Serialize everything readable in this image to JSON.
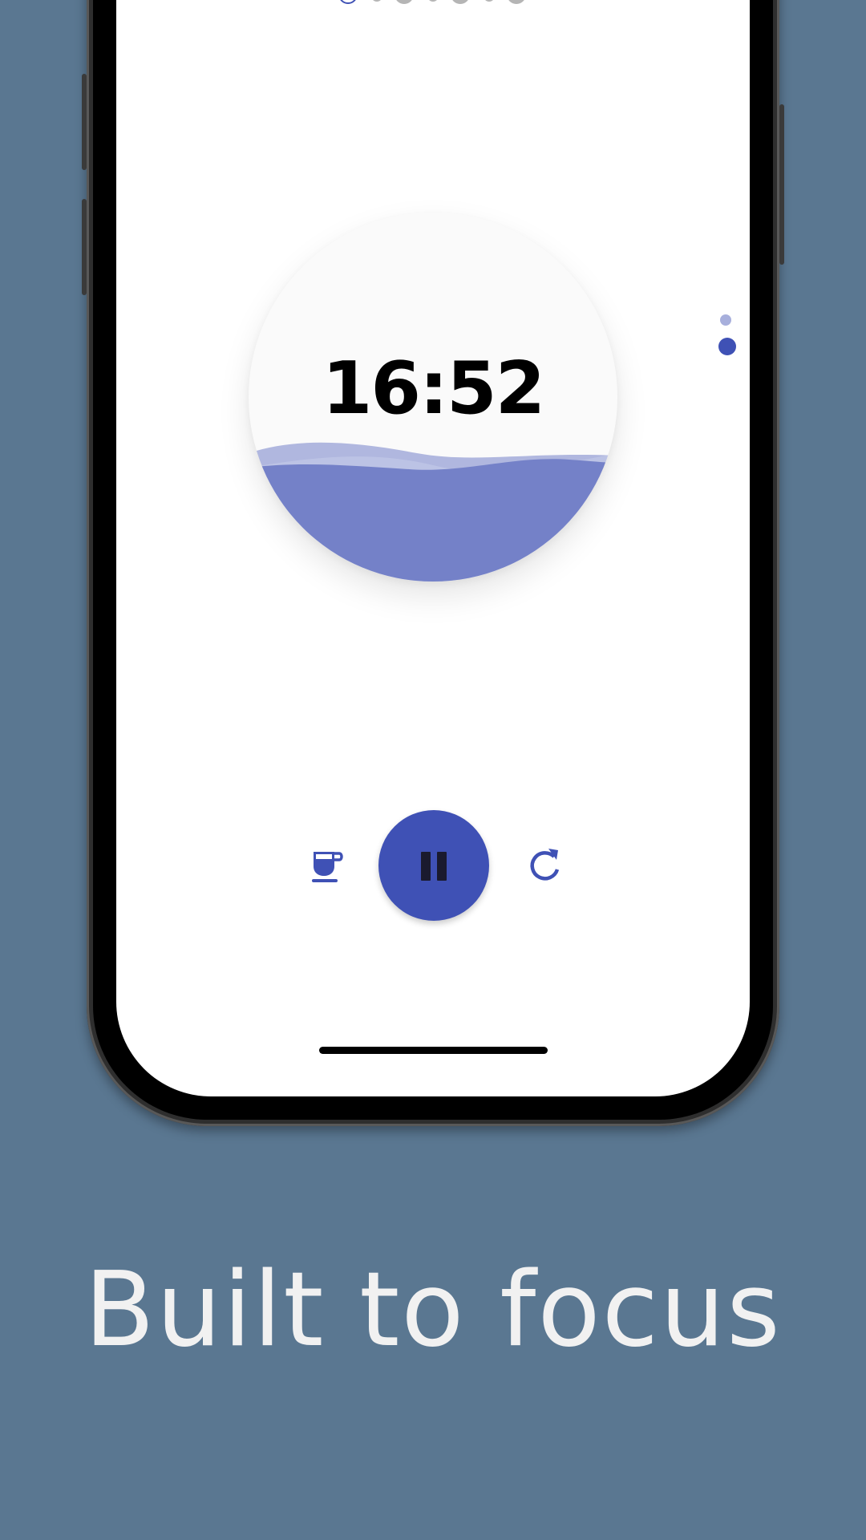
{
  "timer": {
    "time": "16:52",
    "fill_level": 0.37
  },
  "pager": {
    "dot_count": 7,
    "active_index": 0
  },
  "side_pager": {
    "dot_count": 2,
    "active_index": 1
  },
  "controls": {
    "left_icon": "coffee-cup-icon",
    "center_icon": "pause-icon",
    "right_icon": "refresh-icon"
  },
  "tagline": "Built to focus",
  "colors": {
    "background": "#5a7791",
    "accent": "#3f51b5",
    "water": "#7481c8",
    "water_light": "#a7afdc"
  }
}
